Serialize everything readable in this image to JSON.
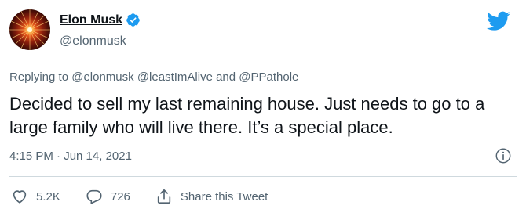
{
  "author": {
    "name": "Elon Musk",
    "handle": "@elonmusk",
    "verified": true
  },
  "tweet": {
    "reply_prefix": "Replying to",
    "reply_to": [
      "@elonmusk",
      "@leastImAlive",
      "@PPathole"
    ],
    "reply_conjunction": "and",
    "text": "Decided to sell my last remaining house. Just needs to go to a large family who will live there. It’s a special place.",
    "time": "4:15 PM · Jun 14, 2021"
  },
  "actions": {
    "likes": "5.2K",
    "replies": "726",
    "share_label": "Share this Tweet"
  },
  "colors": {
    "brand": "#1d9bf0",
    "secondary_text": "#536471"
  },
  "icons": [
    "twitter-bird-icon",
    "verified-badge-icon",
    "info-icon",
    "heart-icon",
    "reply-icon",
    "share-icon"
  ]
}
